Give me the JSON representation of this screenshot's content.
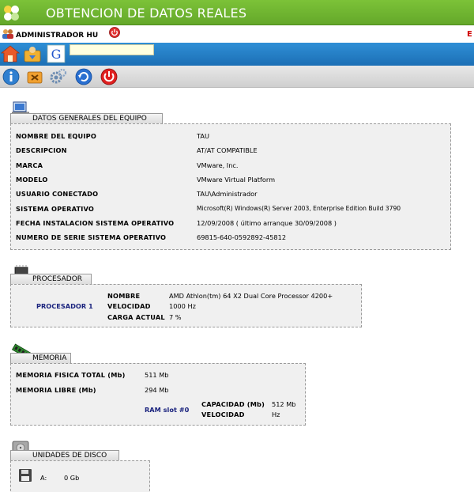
{
  "app": {
    "title": "OBTENCION DE DATOS REALES",
    "user": "ADMINISTRADOR HU",
    "error_mark": "E",
    "search_value": ""
  },
  "toolbar_icons": [
    "home-icon",
    "user-download-icon",
    "google-icon",
    "info-icon",
    "tools-icon",
    "settings-gear-icon",
    "refresh-icon",
    "power-icon"
  ],
  "sections": {
    "equipo": {
      "title": "DATOS GENERALES DEL EQUIPO",
      "rows": [
        {
          "label": "NOMBRE DEL EQUIPO",
          "value": "TAU"
        },
        {
          "label": "DESCRIPCION",
          "value": "AT/AT COMPATIBLE"
        },
        {
          "label": "MARCA",
          "value": "VMware, Inc."
        },
        {
          "label": "MODELO",
          "value": "VMware Virtual Platform"
        },
        {
          "label": "USUARIO CONECTADO",
          "value": "TAU\\Administrador"
        },
        {
          "label": "SISTEMA OPERATIVO",
          "value": "Microsoft(R) Windows(R) Server 2003, Enterprise Edition Build 3790"
        },
        {
          "label": "FECHA INSTALACION SISTEMA OPERATIVO",
          "value": "12/09/2008 ( último arranque 30/09/2008 )"
        },
        {
          "label": "NUMERO DE SERIE SISTEMA OPERATIVO",
          "value": "69815-640-0592892-45812"
        }
      ]
    },
    "procesador": {
      "title": "PROCESADOR",
      "name": "PROCESADOR 1",
      "rows": [
        {
          "label": "NOMBRE",
          "value": "AMD Athlon(tm) 64 X2 Dual Core Processor 4200+"
        },
        {
          "label": "VELOCIDAD",
          "value": "1000 Hz"
        },
        {
          "label": "CARGA ACTUAL",
          "value": "7 %"
        }
      ]
    },
    "memoria": {
      "title": "MEMORIA",
      "rows": [
        {
          "label": "MEMORIA FISICA TOTAL (Mb)",
          "value": "511 Mb"
        },
        {
          "label": "MEMORIA LIBRE (Mb)",
          "value": "294 Mb"
        }
      ],
      "slot": {
        "name": "RAM slot #0",
        "capacity_label": "CAPACIDAD (Mb)",
        "capacity_value": "512 Mb",
        "speed_label": "VELOCIDAD",
        "speed_value": "Hz"
      }
    },
    "discos": {
      "title": "UNIDADES DE DISCO",
      "drive": "A:",
      "size": "0 Gb"
    }
  }
}
